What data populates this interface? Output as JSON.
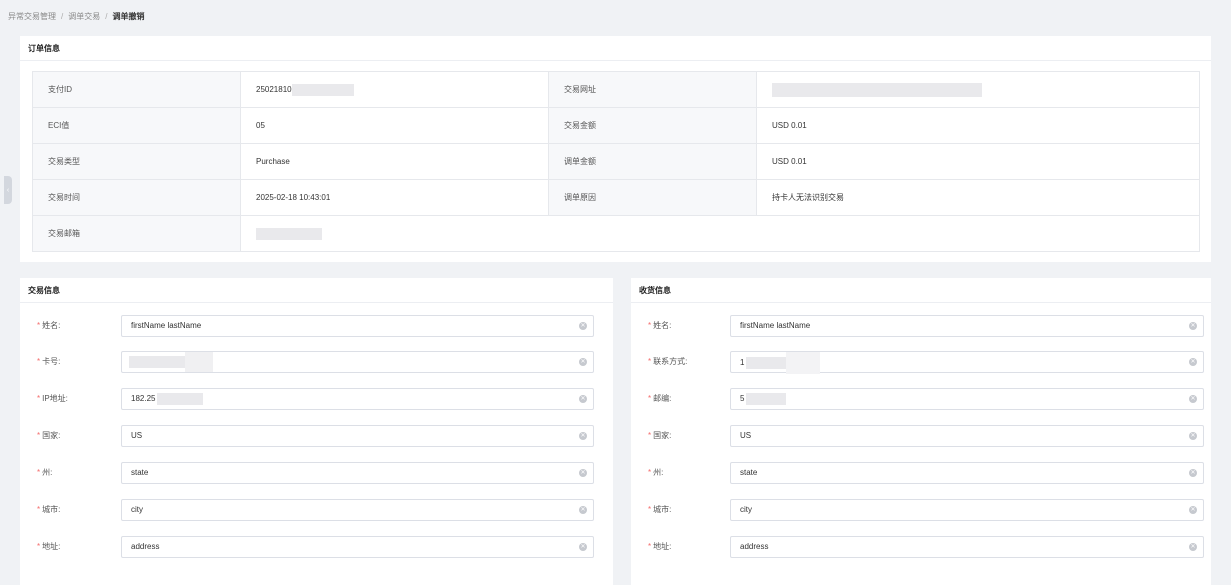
{
  "breadcrumb": [
    "异常交易管理",
    "调单交易",
    "调单撤销"
  ],
  "order_info": {
    "title": "订单信息",
    "rows": [
      {
        "l1": "支付ID",
        "v1": "25021810",
        "l2": "交易网址",
        "v2": ""
      },
      {
        "l1": "ECI值",
        "v1": "05",
        "l2": "交易金额",
        "v2": "USD 0.01"
      },
      {
        "l1": "交易类型",
        "v1": "Purchase",
        "l2": "调单金额",
        "v2": "USD 0.01"
      },
      {
        "l1": "交易时间",
        "v1": "2025-02-18 10:43:01",
        "l2": "调单原因",
        "v2": "持卡人无法识别交易"
      },
      {
        "l1": "交易邮箱",
        "v1": ""
      }
    ]
  },
  "transaction_info": {
    "title": "交易信息",
    "fields": [
      {
        "label": "姓名:",
        "value": "firstName lastName"
      },
      {
        "label": "卡号:",
        "value": ""
      },
      {
        "label": "IP地址:",
        "value": "182.25"
      },
      {
        "label": "国家:",
        "value": "US"
      },
      {
        "label": "州:",
        "value": "state"
      },
      {
        "label": "城市:",
        "value": "city"
      },
      {
        "label": "地址:",
        "value": "address"
      }
    ]
  },
  "shipping_info": {
    "title": "收货信息",
    "fields": [
      {
        "label": "姓名:",
        "value": "firstName lastName"
      },
      {
        "label": "联系方式:",
        "value": "1"
      },
      {
        "label": "邮编:",
        "value": "5"
      },
      {
        "label": "国家:",
        "value": "US"
      },
      {
        "label": "州:",
        "value": "state"
      },
      {
        "label": "城市:",
        "value": "city"
      },
      {
        "label": "地址:",
        "value": "address"
      }
    ]
  },
  "required_mark": "*",
  "clear_icon": "circle-x-icon",
  "colors": {
    "required": "#f56c6c",
    "background": "#f0f2f5",
    "label_cell": "#f7f8fa"
  }
}
